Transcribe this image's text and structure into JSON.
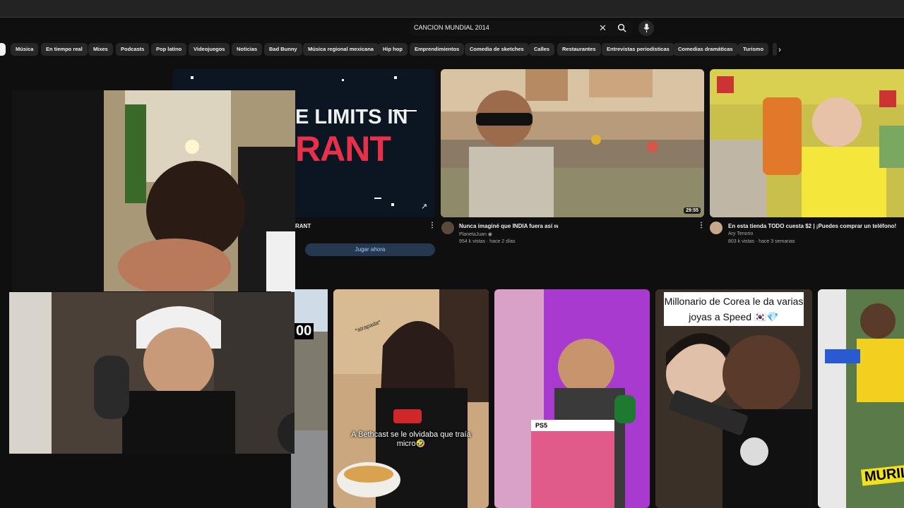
{
  "search": {
    "query": "CANCION MUNDIAL 2014"
  },
  "chips": [
    "",
    "Música",
    "En tiempo real",
    "Mixes",
    "Podcasts",
    "Pop latino",
    "Videojuegos",
    "Noticias",
    "Bad Bunny",
    "Música regional mexicana",
    "Hip hop",
    "Emprendimientos",
    "Comedia de sketches",
    "Calles",
    "Restaurantes",
    "Entrevistas periodísticas",
    "Comedias dramáticas",
    "Turismo",
    ""
  ],
  "videos": [
    {
      "thumb_text_1": "E LIMITS IN",
      "thumb_text_2": "RANT",
      "title": "RANT",
      "cta": "Jugar ahora"
    },
    {
      "title": "Nunca imaginé que INDIA fuera así",
      "badge": "IN",
      "channel": "PlanetaJuan",
      "stats": "954 k vistas · hace 2 días",
      "duration": "29:55"
    },
    {
      "title": "En esta tienda TODO cuesta $2 | ¡Puedes comprar un teléfono!",
      "channel": "Ary Tenorio",
      "stats": "803 k vistas · hace 3 semanas"
    }
  ],
  "shorts": [
    {
      "overlay": "00"
    },
    {
      "sticker": "*atrapada*",
      "caption": "A Bethcast se le olvidaba que traía micro🤣"
    },
    {
      "badge": "PS5"
    },
    {
      "caption": "Millonario de Corea le da varias joyas a Speed 🇰🇷💎"
    },
    {
      "caption": "MURIL"
    }
  ],
  "colors": {
    "background": "#0f0f0f",
    "chip": "#272727",
    "accent_red": "#e8304a",
    "cta": "#3ea6ff"
  },
  "icons": [
    "close-icon",
    "search-icon",
    "mic-icon",
    "chevron-right-icon",
    "more-vert-icon",
    "external-link-icon",
    "verified-icon"
  ]
}
